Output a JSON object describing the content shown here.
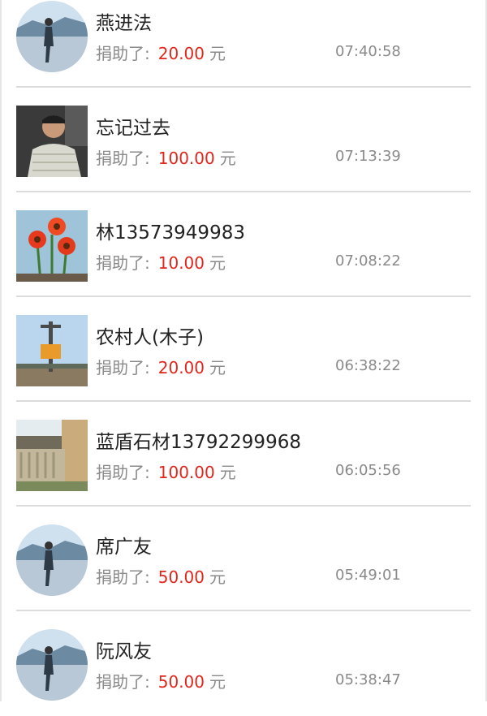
{
  "donations": [
    {
      "name": "燕进法",
      "label": "捐助了:",
      "amount": "20.00",
      "unit": "元",
      "time": "07:40:58",
      "avatar": "landscape-avatar-icon"
    },
    {
      "name": "忘记过去",
      "label": "捐助了:",
      "amount": "100.00",
      "unit": "元",
      "time": "07:13:39",
      "avatar": "portrait-avatar-icon"
    },
    {
      "name": "林13573949983",
      "label": "捐助了:",
      "amount": "10.00",
      "unit": "元",
      "time": "07:08:22",
      "avatar": "flowers-avatar-icon"
    },
    {
      "name": "农村人(木子)",
      "label": "捐助了:",
      "amount": "20.00",
      "unit": "元",
      "time": "06:38:22",
      "avatar": "monument-avatar-icon"
    },
    {
      "name": "蓝盾石材13792299968",
      "label": "捐助了:",
      "amount": "100.00",
      "unit": "元",
      "time": "06:05:56",
      "avatar": "stone-railing-avatar-icon"
    },
    {
      "name": "席广友",
      "label": "捐助了:",
      "amount": "50.00",
      "unit": "元",
      "time": "05:49:01",
      "avatar": "landscape-avatar-icon"
    },
    {
      "name": "阮风友",
      "label": "捐助了:",
      "amount": "50.00",
      "unit": "元",
      "time": "05:38:47",
      "avatar": "landscape-avatar-icon"
    }
  ],
  "colors": {
    "amount": "#e1261c",
    "secondary_text": "#8a8a8a",
    "divider": "#dcdcdc"
  }
}
